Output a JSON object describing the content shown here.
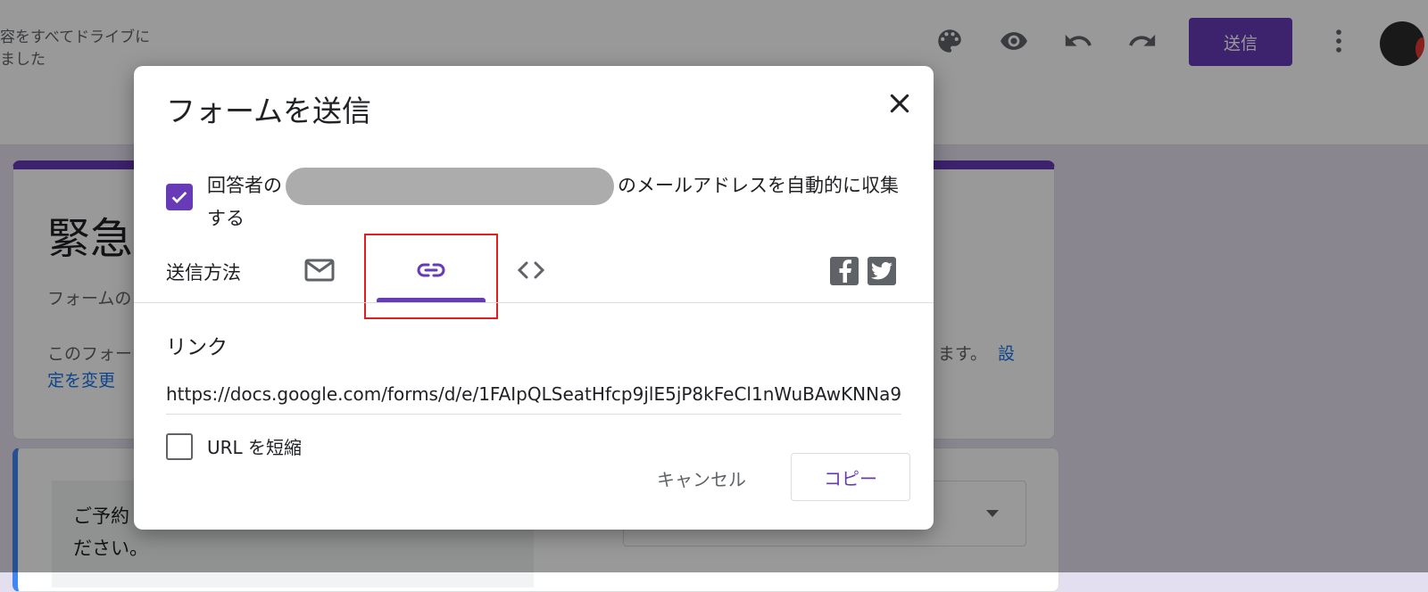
{
  "header": {
    "autosave_line1": "容をすべてドライブに",
    "autosave_line2": "ました",
    "icons": [
      "palette-icon",
      "eye-icon",
      "undo-icon",
      "redo-icon",
      "more-vert-icon"
    ],
    "send_label": "送信"
  },
  "form": {
    "title": "緊急",
    "description": "フォームの",
    "note_left": "このフォー",
    "note_right": "ます。",
    "note_link_a": "設",
    "note_link_b": "定を変更",
    "question_line1": "ご予約",
    "question_line2": "ださい。"
  },
  "dialog": {
    "title": "フォームを送信",
    "collect_prefix": "回答者の",
    "collect_suffix": "のメールアドレスを自動的に収集する",
    "send_method_label": "送信方法",
    "tabs": [
      {
        "name": "email",
        "icon": "mail-icon"
      },
      {
        "name": "link",
        "icon": "link-icon",
        "selected": true
      },
      {
        "name": "embed",
        "icon": "code-icon"
      }
    ],
    "social": [
      "facebook-icon",
      "twitter-icon"
    ],
    "link_heading": "リンク",
    "url": "https://docs.google.com/forms/d/e/1FAIpQLSeatHfcp9jlE5jP8kFeCl1nWuBAwKNNa9",
    "shorten_label": "URL を短縮",
    "cancel_label": "キャンセル",
    "copy_label": "コピー"
  },
  "colors": {
    "accent": "#673ab7",
    "highlight_box": "#e0201e",
    "link": "#1a73e8"
  }
}
